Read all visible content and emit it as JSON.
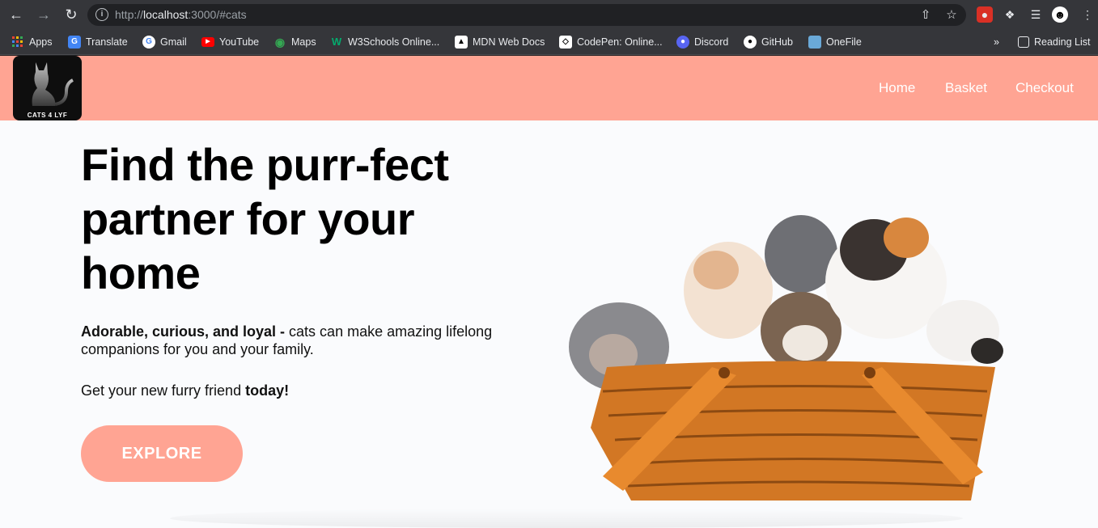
{
  "browser": {
    "url_scheme": "http://",
    "url_host": "localhost",
    "url_rest": ":3000/#cats",
    "bookmarks": [
      {
        "label": "Apps",
        "icon": "apps-grid-icon",
        "color": "#4285f4"
      },
      {
        "label": "Translate",
        "icon": "translate-icon",
        "color": "#4285f4"
      },
      {
        "label": "Gmail",
        "icon": "google-icon",
        "color": "#ffffff"
      },
      {
        "label": "YouTube",
        "icon": "youtube-icon",
        "color": "#ff0000"
      },
      {
        "label": "Maps",
        "icon": "maps-pin-icon",
        "color": "#34a853"
      },
      {
        "label": "W3Schools Online...",
        "icon": "w3schools-icon",
        "color": "#04aa6d"
      },
      {
        "label": "MDN Web Docs",
        "icon": "mdn-icon",
        "color": "#000000"
      },
      {
        "label": "CodePen: Online...",
        "icon": "codepen-icon",
        "color": "#ffffff"
      },
      {
        "label": "Discord",
        "icon": "discord-icon",
        "color": "#5865f2"
      },
      {
        "label": "GitHub",
        "icon": "github-icon",
        "color": "#ffffff"
      },
      {
        "label": "OneFile",
        "icon": "onefile-icon",
        "color": "#6aa9d8"
      }
    ],
    "overflow_label": "»",
    "reading_list": "Reading List"
  },
  "site": {
    "logo_text": "CATS 4 LYF",
    "nav": [
      "Home",
      "Basket",
      "Checkout"
    ],
    "hero": {
      "title": "Find the purr-fect partner for your home",
      "sub_bold": "Adorable, curious, and loyal -",
      "sub_rest": " cats can make amazing lifelong companions for you and your family.",
      "cta_pre": "Get your new furry friend ",
      "cta_bold": "today!",
      "button": "EXPLORE"
    },
    "colors": {
      "header": "#ffa493",
      "button": "#ffa493",
      "page_bg": "#fafbfd"
    }
  }
}
